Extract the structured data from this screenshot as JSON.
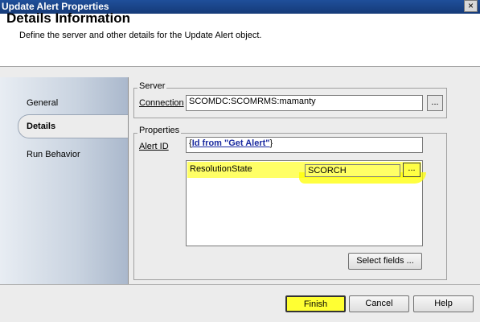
{
  "window": {
    "title": "Update Alert Properties",
    "close_glyph": "×"
  },
  "header": {
    "title": "Details Information",
    "description": "Define the server and other details for the Update Alert object."
  },
  "nav": {
    "items": [
      {
        "label": "General",
        "selected": false
      },
      {
        "label": "Details",
        "selected": true
      },
      {
        "label": "Run Behavior",
        "selected": false
      }
    ]
  },
  "server_group": {
    "legend": "Server",
    "connection_label": "Connection",
    "connection_value": "SCOMDC:SCOMRMS:mamanty",
    "browse_label": "..."
  },
  "properties_group": {
    "legend": "Properties",
    "alert_id_label": "Alert ID",
    "alert_id_prefix": "{",
    "alert_id_value": "Id from \"Get Alert\"",
    "alert_id_suffix": "}",
    "fields": [
      {
        "name": "ResolutionState",
        "value": "SCORCH",
        "browse_label": "..."
      }
    ],
    "select_fields_label": "Select fields ..."
  },
  "footer": {
    "finish_label": "Finish",
    "cancel_label": "Cancel",
    "help_label": "Help"
  },
  "colors": {
    "highlight": "#ffff33",
    "title_bar": "#1f4f9a",
    "link": "#1a2aa0"
  }
}
